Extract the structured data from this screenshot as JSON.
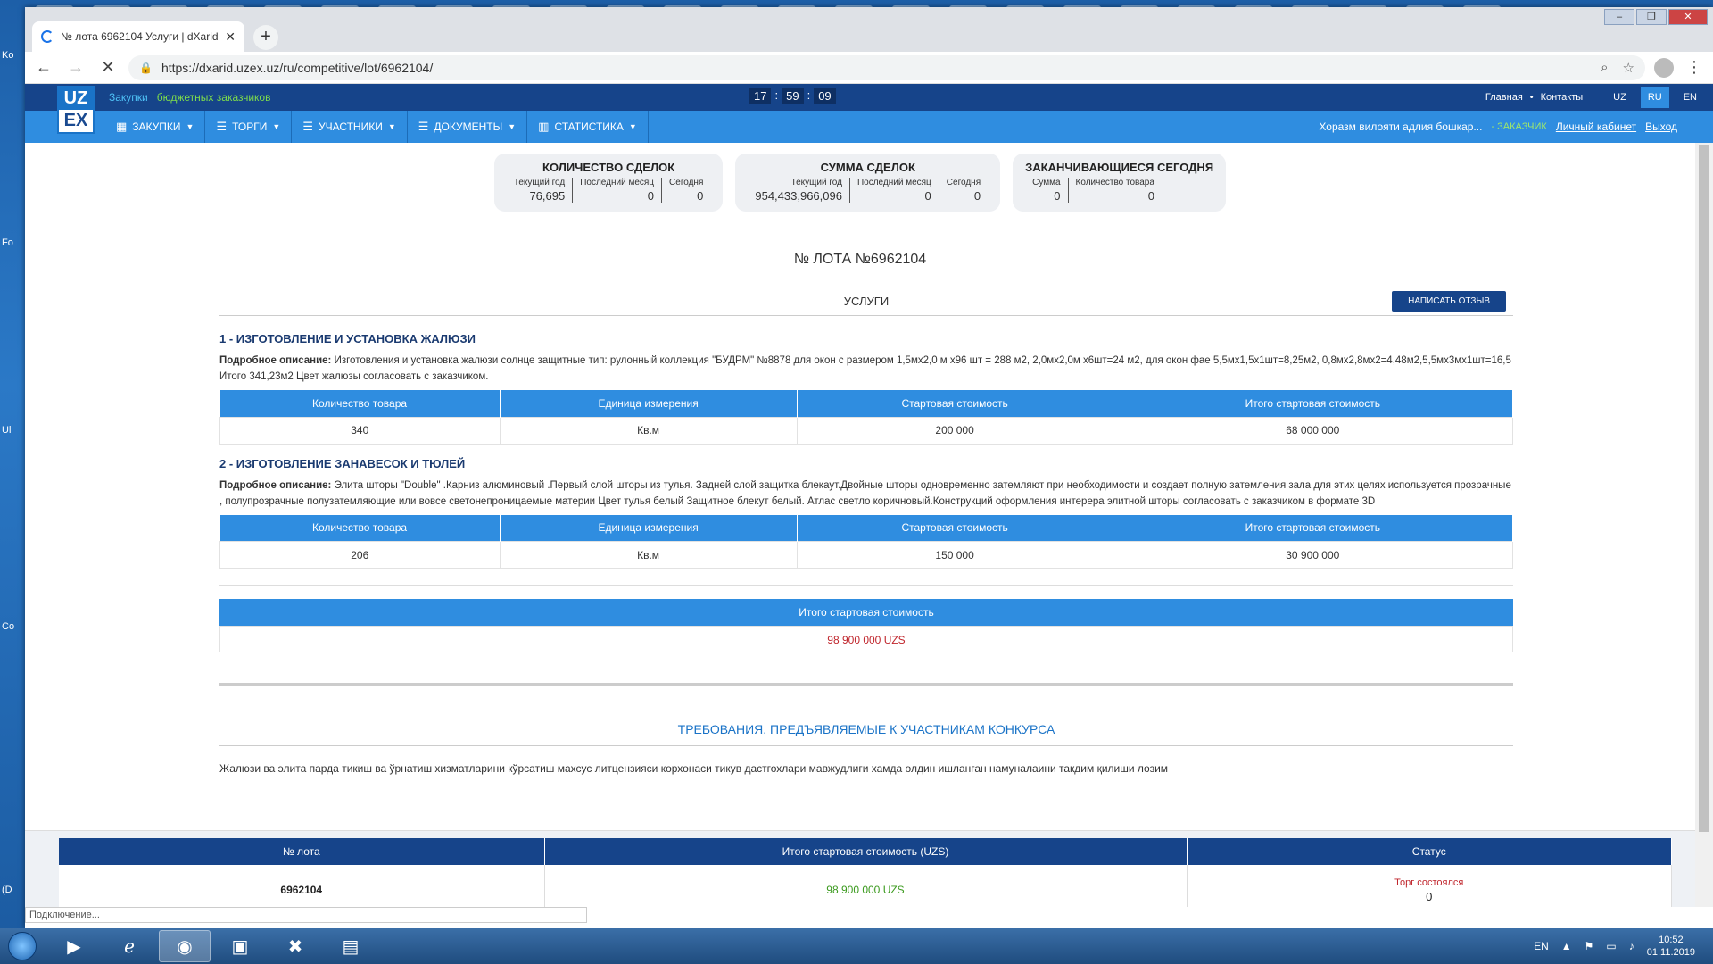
{
  "browser": {
    "tab_title": "№ лота 6962104 Услуги | dXarid",
    "url": "https://dxarid.uzex.uz/ru/competitive/lot/6962104/",
    "status_text": "Подключение..."
  },
  "site": {
    "logo_top": "UZ",
    "logo_bottom": "EX",
    "subnav": [
      "Закупки",
      "бюджетных заказчиков"
    ],
    "clock": [
      "17",
      "59",
      "09"
    ],
    "top_links": [
      "Главная",
      "Контакты"
    ],
    "languages": [
      "UZ",
      "RU",
      "EN"
    ],
    "active_language": "RU",
    "menu": [
      {
        "label": "ЗАКУПКИ",
        "icon": "grid-icon"
      },
      {
        "label": "ТОРГИ",
        "icon": "list-icon"
      },
      {
        "label": "УЧАСТНИКИ",
        "icon": "list-icon"
      },
      {
        "label": "ДОКУМЕНТЫ",
        "icon": "list-icon"
      },
      {
        "label": "СТАТИСТИКА",
        "icon": "bar-chart-icon"
      }
    ],
    "user_org": "Хоразм вилояти адлия бошкар...",
    "user_role": "- ЗАКАЗЧИК",
    "cabinet_link": "Личный кабинет",
    "logout_link": "Выход"
  },
  "stats": [
    {
      "title": "КОЛИЧЕСТВО СДЕЛОК",
      "cols": [
        {
          "label": "Текущий год",
          "value": "76,695"
        },
        {
          "label": "Последний месяц",
          "value": "0"
        },
        {
          "label": "Сегодня",
          "value": "0"
        }
      ]
    },
    {
      "title": "СУММА СДЕЛОК",
      "cols": [
        {
          "label": "Текущий год",
          "value": "954,433,966,096"
        },
        {
          "label": "Последний месяц",
          "value": "0"
        },
        {
          "label": "Сегодня",
          "value": "0"
        }
      ]
    },
    {
      "title": "ЗАКАНЧИВАЮЩИЕСЯ СЕГОДНЯ",
      "cols": [
        {
          "label": "Сумма",
          "value": "0"
        },
        {
          "label": "Количество товара",
          "value": "0"
        }
      ]
    }
  ],
  "lot": {
    "title": "№ ЛОТА №6962104",
    "category": "УСЛУГИ",
    "review_button": "НАПИСАТЬ ОТЗЫВ",
    "table_headers": [
      "Количество товара",
      "Единица измерения",
      "Стартовая стоимость",
      "Итого стартовая стоимость"
    ],
    "desc_label": "Подробное описание:",
    "items": [
      {
        "title": "1 - ИЗГОТОВЛЕНИЕ И УСТАНОВКА ЖАЛЮЗИ",
        "description": "Изготовления и установка жалюзи солнце защитные тип: рулонный коллекция \"БУДРМ\" №8878 для окон с размером 1,5мх2,0 м х96 шт = 288 м2, 2,0мх2,0м х6шт=24 м2, для окон фае 5,5мх1,5х1шт=8,25м2, 0,8мх2,8мх2=4,48м2,5,5мх3мх1шт=16,5 Итого 341,23м2 Цвет жалюзы согласовать с заказчиком.",
        "quantity": "340",
        "unit": "Кв.м",
        "start_price": "200 000",
        "total_price": "68 000 000"
      },
      {
        "title": "2 - ИЗГОТОВЛЕНИЕ ЗАНАВЕСОК И ТЮЛЕЙ",
        "description": "Элита шторы \"Double\" .Карниз алюминовый .Первый слой шторы из тулья. Задней слой защитка блекаут.Двойные шторы одновременно затемляют при необходимости и создает полную затемления зала для этих целях используется прозрачные , полупрозрачные полузатемляющие или вовсе светонепроницаемые материи Цвет тулья белый Защитное блекут белый. Атлас светло коричновый.Конструкций оформления интерера элитной шторы согласовать с заказчиком в формате 3D",
        "quantity": "206",
        "unit": "Кв.м",
        "start_price": "150 000",
        "total_price": "30 900 000"
      }
    ],
    "total_header": "Итого стартовая стоимость",
    "total_value": "98 900 000 UZS",
    "requirements_title": "ТРЕБОВАНИЯ, ПРЕДЪЯВЛЯЕМЫЕ К УЧАСТНИКАМ КОНКУРСА",
    "requirements_text": "Жалюзи ва элита парда тикиш ва ўрнатиш хизматларини кўрсатиш махсус литцензияси корхонаси тикув дастгохлари мавжудлиги хамда олдин ишланган намуналаини такдим қилиши лозим"
  },
  "summary": {
    "headers": [
      "№ лота",
      "Итого стартовая стоимость (UZS)",
      "Статус"
    ],
    "lot_number": "6962104",
    "total": "98 900 000 UZS",
    "status": "Торг состоялся",
    "status_count": "0"
  },
  "taskbar": {
    "lang": "EN",
    "time": "10:52",
    "date": "01.11.2019"
  },
  "desktop_labels": [
    "Ko",
    "Fo",
    "Ul",
    "Co",
    "(D"
  ],
  "colors": {
    "accent": "#2f8de0",
    "dark": "#16448a",
    "price_red": "#c0262d",
    "price_green": "#3b9a1e"
  }
}
